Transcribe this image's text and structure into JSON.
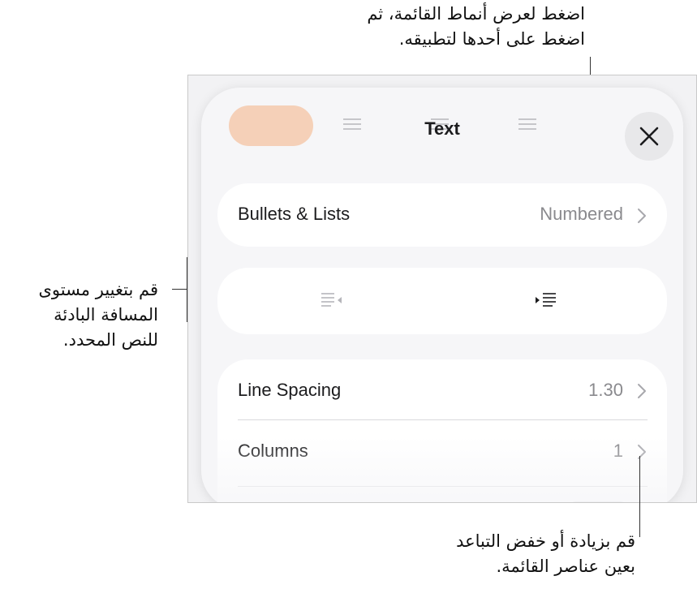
{
  "callouts": {
    "top": [
      "اضغط لعرض أنماط القائمة، ثم",
      "اضغط على أحدها لتطبيقه."
    ],
    "left": [
      "قم بتغيير مستوى",
      "المسافة البادئة",
      "للنص المحدد."
    ],
    "bottom": [
      "قم بزيادة أو خفض التباعد",
      "بعين عناصر القائمة."
    ]
  },
  "panel": {
    "title": "Text",
    "close_icon": "close-icon",
    "rows": {
      "bullets": {
        "label": "Bullets & Lists",
        "value": "Numbered"
      },
      "line_spacing": {
        "label": "Line Spacing",
        "value": "1.30"
      },
      "columns": {
        "label": "Columns",
        "value": "1"
      }
    },
    "indent": {
      "decrease_icon": "outdent-icon",
      "increase_icon": "indent-icon"
    }
  },
  "colors": {
    "accent": "#f39a5b",
    "panel_bg": "#f6f6f8",
    "card_bg": "#ffffff",
    "value_gray": "#8a8a8e"
  }
}
